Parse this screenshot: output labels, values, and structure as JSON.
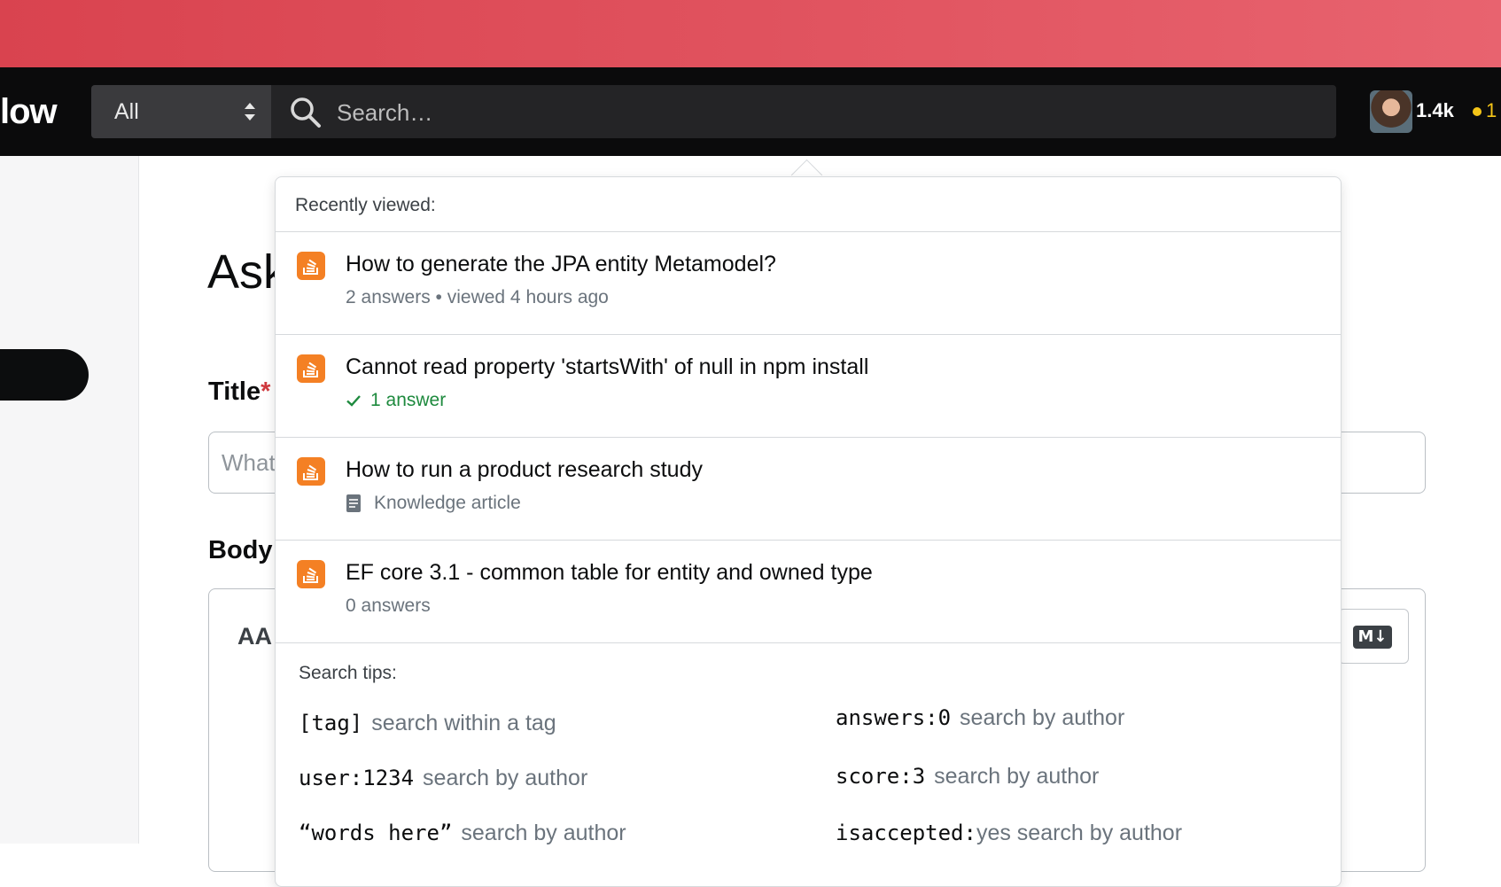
{
  "navbar": {
    "logo_text": "low",
    "scope": {
      "selected": "All"
    },
    "search": {
      "placeholder": "Search…"
    },
    "user": {
      "reputation": "1.4k",
      "badge_count": "1"
    }
  },
  "page": {
    "heading": "Ask",
    "title_label": "Title",
    "required_mark": "*",
    "title_placeholder": "What",
    "body_label": "Body",
    "text_size_icon": "AA",
    "markdown_badge": "M↓"
  },
  "dropdown": {
    "recent_header": "Recently viewed:",
    "results": [
      {
        "title": "How to generate the JPA entity Metamodel?",
        "meta": "2 answers • viewed 4 hours ago",
        "kind": "plain"
      },
      {
        "title": "Cannot read property 'startsWith' of null in npm install",
        "meta": "1 answer",
        "kind": "accepted"
      },
      {
        "title": "How to run a product research study",
        "meta": "Knowledge article",
        "kind": "article"
      },
      {
        "title": "EF core 3.1 - common table for entity and owned type",
        "meta": "0 answers",
        "kind": "plain"
      }
    ],
    "tips_header": "Search tips:",
    "tips": [
      {
        "code": "[tag]",
        "desc": "search within a tag"
      },
      {
        "code": "answers:0",
        "desc": "search by author"
      },
      {
        "code": "user:1234",
        "desc": "search by author"
      },
      {
        "code": "score:3",
        "desc": "search by author"
      },
      {
        "code": "“words here”",
        "desc": "search by author"
      },
      {
        "code": "isaccepted:",
        "desc": "yes search by author"
      }
    ]
  },
  "colors": {
    "accent_strip": "#e0525e",
    "navbar_bg": "#0b0b0c",
    "so_orange": "#f48024",
    "accepted_green": "#1e8a3e"
  }
}
